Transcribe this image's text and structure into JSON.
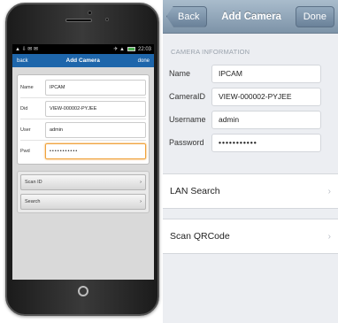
{
  "android": {
    "status": {
      "left_icons": "▲ ⇩ ✉ ✉",
      "right_icons": "✈ ▲",
      "time": "22:03"
    },
    "nav": {
      "back": "back",
      "title": "Add Camera",
      "done": "done"
    },
    "fields": [
      {
        "label": "Name",
        "value": "IPCAM"
      },
      {
        "label": "Did",
        "value": "VIEW-000002-PYJEE"
      },
      {
        "label": "User",
        "value": "admin"
      },
      {
        "label": "Pwd",
        "value": "•••••••••••"
      }
    ],
    "buttons": [
      {
        "label": "Scan ID",
        "chevron": "›"
      },
      {
        "label": "Search",
        "chevron": "›"
      }
    ]
  },
  "ios": {
    "nav": {
      "back": "Back",
      "title": "Add Camera",
      "done": "Done"
    },
    "section_header": "CAMERA INFORMATION",
    "fields": [
      {
        "label": "Name",
        "value": "IPCAM"
      },
      {
        "label": "CameraID",
        "value": "VIEW-000002-PYJEE"
      },
      {
        "label": "Username",
        "value": "admin"
      },
      {
        "label": "Password",
        "value": "•••••••••••"
      }
    ],
    "cells": [
      {
        "label": "LAN Search",
        "chevron": "›"
      },
      {
        "label": "Scan QRCode",
        "chevron": "›"
      }
    ]
  },
  "colors": {
    "android_nav": "#1e66ab",
    "focus_border": "#f0a23a",
    "ios_nav": "#8da2b6",
    "ios_background": "#eceef2"
  }
}
